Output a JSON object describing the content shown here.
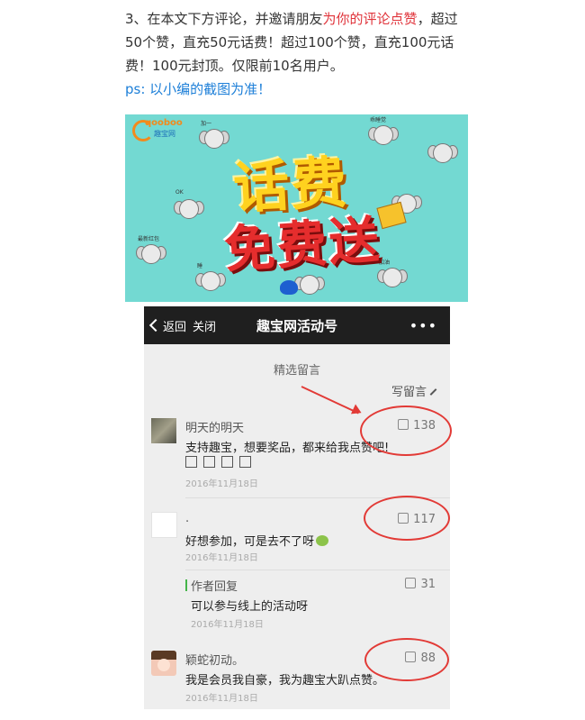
{
  "article": {
    "line1_prefix": "3、在本文下方评论，并邀请朋友",
    "line1_highlight": "为你的评论点赞",
    "line1_suffix": "，超过",
    "line2": "50个赞，直充50元话费！超过100个赞，直充100元话",
    "line3": "费！100元封顶。仅限前10名用户。",
    "line4": "ps: 以小编的截图为准！"
  },
  "banner": {
    "logo_text": "qooboo",
    "logo_sub": "趣宝网",
    "title_top": "话费",
    "title_bottom": "免费送",
    "ok_tag": "OK",
    "tags": [
      "加一",
      "乖睡觉",
      "嘎嘎",
      "最新红包",
      "睡",
      "加油"
    ]
  },
  "phone": {
    "nav": {
      "back_label": "返回",
      "close_label": "关闭",
      "title": "趣宝网活动号",
      "more_icon": "more-icon"
    },
    "section_title": "精选留言",
    "write_label": "写留言",
    "comments": [
      {
        "name": "明天的明天",
        "text": "支持趣宝，想要奖品，都来给我点赞吧!",
        "boxes": "□□□□",
        "date": "2016年11月18日",
        "likes": "138"
      },
      {
        "name": ".",
        "text": "好想参加，可是去不了呀",
        "date": "2016年11月18日",
        "likes": "117"
      },
      {
        "reply_label": "作者回复",
        "text": "可以参与线上的活动呀",
        "date": "2016年11月18日",
        "likes": "31"
      },
      {
        "name": "颖蛇初动。",
        "text": "我是会员我自豪，我为趣宝大趴点赞。",
        "date": "2016年11月18日",
        "likes": "88"
      }
    ]
  },
  "colors": {
    "highlight_red": "#e0343b",
    "link_blue": "#1d7fd8",
    "banner_bg": "#73d9d2",
    "nav_bg": "#1f1f1f",
    "annotation_red": "#e23a36",
    "reply_green": "#44b549"
  }
}
